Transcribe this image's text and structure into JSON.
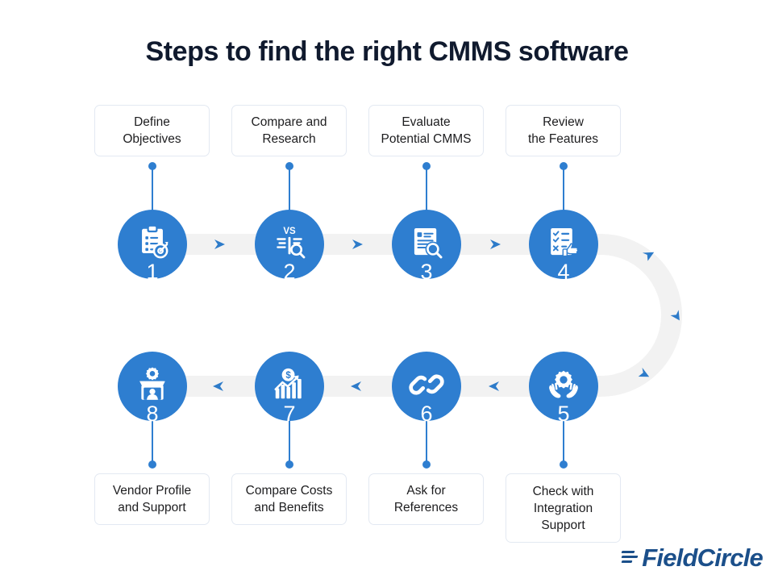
{
  "page": {
    "title": "Steps to find the right CMMS software",
    "background_color": "#ffffff",
    "accent_color": "#2e7ed0",
    "title_color": "#101a2e",
    "track_color": "#f2f2f2",
    "box_border_color": "#e3e9f2"
  },
  "steps": [
    {
      "number": "1",
      "label": "Define\nObjectives",
      "icon": "clipboard-target-icon",
      "row": "top"
    },
    {
      "number": "2",
      "label": "Compare and\nResearch",
      "icon": "versus-search-icon",
      "row": "top"
    },
    {
      "number": "3",
      "label": "Evaluate\nPotential CMMS",
      "icon": "document-search-icon",
      "row": "top"
    },
    {
      "number": "4",
      "label": "Review\nthe Features",
      "icon": "checklist-thumbsup-icon",
      "row": "top"
    },
    {
      "number": "5",
      "label": "Check with\nIntegration\nSupport",
      "icon": "hands-gear-icon",
      "row": "bottom"
    },
    {
      "number": "6",
      "label": "Ask for\nReferences",
      "icon": "chain-link-icon",
      "row": "bottom"
    },
    {
      "number": "7",
      "label": "Compare Costs\nand Benefits",
      "icon": "growth-chart-dollar-icon",
      "row": "bottom"
    },
    {
      "number": "8",
      "label": "Vendor Profile\nand Support",
      "icon": "vendor-storefront-icon",
      "row": "bottom"
    }
  ],
  "flow": {
    "top_row_direction": "left-to-right",
    "bottom_row_direction": "right-to-left",
    "arrow_count_top": 3,
    "arrow_count_bottom": 3,
    "arrow_count_curve": 3
  },
  "brand": {
    "name": "FieldCircle",
    "color": "#1b4f8a"
  }
}
